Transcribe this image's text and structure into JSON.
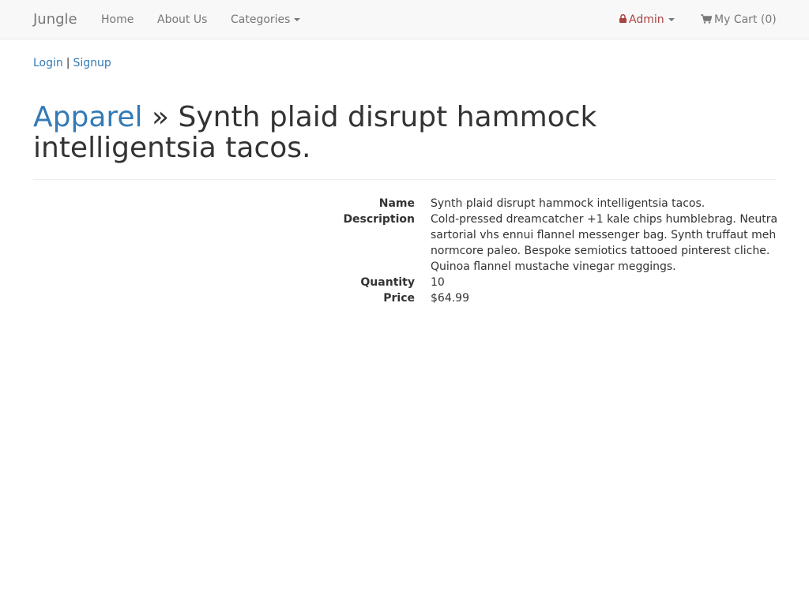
{
  "navbar": {
    "brand": "Jungle",
    "items": [
      {
        "label": "Home"
      },
      {
        "label": "About Us"
      },
      {
        "label": "Categories"
      }
    ],
    "admin_label": "Admin",
    "cart_label": "My Cart (0)",
    "icons": {
      "admin": "lock-icon",
      "cart": "shopping-cart-icon"
    },
    "colors": {
      "admin": "#a94442",
      "link": "#337ab7"
    }
  },
  "auth": {
    "login": "Login",
    "separator": "|",
    "signup": "Signup"
  },
  "product": {
    "category": "Apparel",
    "title_separator": "»",
    "title": "Synth plaid disrupt hammock intelligentsia tacos.",
    "fields": {
      "name_label": "Name",
      "name_value": "Synth plaid disrupt hammock intelligentsia tacos.",
      "description_label": "Description",
      "description_value": "Cold-pressed dreamcatcher +1 kale chips humblebrag. Neutra sartorial vhs ennui flannel messenger bag. Synth truffaut meh normcore paleo. Bespoke semiotics tattooed pinterest cliche. Quinoa flannel mustache vinegar meggings.",
      "quantity_label": "Quantity",
      "quantity_value": "10",
      "price_label": "Price",
      "price_value": "$64.99"
    }
  }
}
